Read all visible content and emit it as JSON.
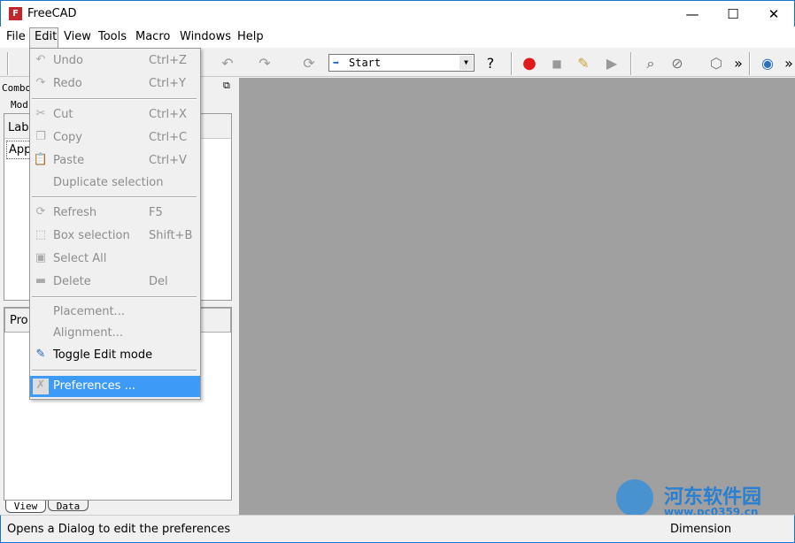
{
  "window": {
    "title": "FreeCAD",
    "minimize": "—",
    "maximize": "☐",
    "close": "✕"
  },
  "menubar": [
    "File",
    "Edit",
    "View",
    "Tools",
    "Macro",
    "Windows",
    "Help"
  ],
  "toolbar": {
    "workbench": "Start",
    "overflow": "»"
  },
  "combo": {
    "title": "Combo",
    "tab_model": "Mod",
    "label_header": "Labe",
    "app_item": "App",
    "prop_header": "Pro",
    "tab_view": "View",
    "tab_data": "Data"
  },
  "edit_menu": [
    {
      "label": "Undo",
      "shortcut": "Ctrl+Z",
      "icon": "undo-icon"
    },
    {
      "label": "Redo",
      "shortcut": "Ctrl+Y",
      "icon": "redo-icon"
    },
    {
      "label": "Cut",
      "shortcut": "Ctrl+X",
      "icon": "scissors-icon"
    },
    {
      "label": "Copy",
      "shortcut": "Ctrl+C",
      "icon": "copy-icon"
    },
    {
      "label": "Paste",
      "shortcut": "Ctrl+V",
      "icon": "paste-icon"
    },
    {
      "label": "Duplicate selection",
      "shortcut": ""
    },
    {
      "label": "Refresh",
      "shortcut": "F5",
      "icon": "refresh-icon"
    },
    {
      "label": "Box selection",
      "shortcut": "Shift+B",
      "icon": "box-selection-icon"
    },
    {
      "label": "Select All",
      "shortcut": "",
      "icon": "select-all-icon"
    },
    {
      "label": "Delete",
      "shortcut": "Del",
      "icon": "delete-icon"
    },
    {
      "label": "Placement...",
      "shortcut": ""
    },
    {
      "label": "Alignment...",
      "shortcut": ""
    },
    {
      "label": "Toggle Edit mode",
      "shortcut": "",
      "icon": "pencil-icon"
    },
    {
      "label": "Preferences ...",
      "shortcut": "",
      "icon": "tools-icon"
    }
  ],
  "status": {
    "message": "Opens a Dialog to edit the preferences",
    "right": "Dimension"
  },
  "watermark": {
    "text": "河东软件园",
    "url": "www.pc0359.cn"
  },
  "colors": {
    "highlight": "#3d9bf7",
    "view_bg": "#a0a0a0"
  }
}
